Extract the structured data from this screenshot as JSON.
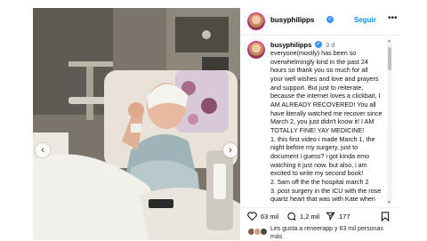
{
  "post": {
    "username": "busyphilipps",
    "follow_label": "Seguir",
    "more_label": "•••",
    "caption_username": "busyphilipps",
    "time_ago": "3 d",
    "caption": "everyone(mostly) has been so\noverwhelmingly kind in the past 24\nhours so thank you so much for all\nyour well wishes and love and prayers\nand support. But just to reiterate,\nbecause the internet loves a clickbait, I\nAM ALREADY RECOVERED! You all\nhave literally watched me recover since\nMarch 2, you just didn't know it! I AM\nTOTALLY FINE! YAY MEDICINE!\n1. this first video i made March 1, the\nnight before my surgery, just to\ndocument i guess? i got kinda emo\nwatching it just now. but also, i am\nexcited to write my second book!\n 2. 5am off the the hospital march 2\n3. post surgery in the ICU with the rose\nquartz heart that was with Kate when"
  },
  "actions": {
    "likes_count": "63 mil",
    "comments_count": "1,2 mil",
    "shares_count": "177"
  },
  "likes_line": "Les gusta a reneerapp y 63 mil personas más",
  "icons": {
    "like": "heart-icon",
    "comment": "comment-icon",
    "share": "share-icon",
    "save": "bookmark-icon",
    "prev": "chevron-left-icon",
    "next": "chevron-right-icon",
    "verified": "verified-badge-icon"
  },
  "colors": {
    "follow": "#0095f6",
    "verified": "#3897f0",
    "muted": "#737373"
  }
}
